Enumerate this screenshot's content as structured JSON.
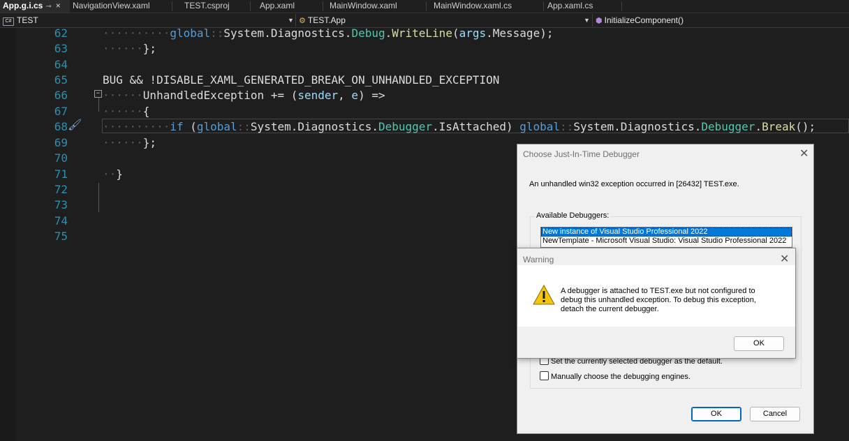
{
  "tabs": [
    {
      "label": "App.g.i.cs",
      "active": true
    },
    {
      "label": "NavigationView.xaml"
    },
    {
      "label": "TEST.csproj"
    },
    {
      "label": "App.xaml"
    },
    {
      "label": "MainWindow.xaml"
    },
    {
      "label": "MainWindow.xaml.cs"
    },
    {
      "label": "App.xaml.cs"
    }
  ],
  "navbar": {
    "project": "TEST",
    "project_icon": "C#",
    "class": "TEST.App",
    "member": "InitializeComponent()"
  },
  "editor": {
    "line_numbers": [
      "62",
      "63",
      "64",
      "65",
      "66",
      "67",
      "68",
      "69",
      "70",
      "71",
      "72",
      "73",
      "74",
      "75"
    ],
    "lines": {
      "l62_global": "global",
      "l62_sep": "::",
      "l62_system": "System",
      "l62_diag": "Diagnostics",
      "l62_debug": "Debug",
      "l62_write": "WriteLine",
      "l62_args": "args",
      "l62_message": "Message",
      "l62_end": ");",
      "l63": "};",
      "l65": "BUG && !DISABLE_XAML_GENERATED_BREAK_ON_UNHANDLED_EXCEPTION",
      "l66_evt": "UnhandledException",
      "l66_op": " += (",
      "l66_sender": "sender",
      "l66_comma": ", ",
      "l66_e": "e",
      "l66_arrow": ") =>",
      "l67": "{",
      "l68_if": "if",
      "l68_open": " (",
      "l68_global": "global",
      "l68_system": "System",
      "l68_diag": "Diagnostics",
      "l68_debugger": "Debugger",
      "l68_attached": "IsAttached",
      "l68_close": ") ",
      "l68_global2": "global",
      "l68_break": "Break",
      "l68_end": "();",
      "l69": "};",
      "l71": "}"
    }
  },
  "jit_dialog": {
    "title": "Choose Just-In-Time Debugger",
    "message": "An unhandled win32 exception occurred in [26432] TEST.exe.",
    "group_label": "Available Debuggers:",
    "debuggers": [
      "New instance of Visual Studio Professional 2022",
      "NewTemplate - Microsoft Visual Studio: Visual Studio Professional 2022"
    ],
    "checkbox_default": "Set the currently selected debugger as the default.",
    "checkbox_manual": "Manually choose the debugging engines.",
    "ok": "OK",
    "cancel": "Cancel"
  },
  "warning_dialog": {
    "title": "Warning",
    "message_lines": [
      "A debugger is attached to TEST.exe but not configured to",
      "debug this unhandled exception. To debug this exception,",
      "detach the current debugger."
    ],
    "ok": "OK"
  },
  "colors": {
    "editor_bg": "#1e1e1e",
    "line_number": "#2b91af",
    "keyword": "#569cd6",
    "type": "#4ec9b0",
    "method": "#dcdcaa",
    "parameter": "#9cdcfe",
    "selection": "#0078d7"
  }
}
